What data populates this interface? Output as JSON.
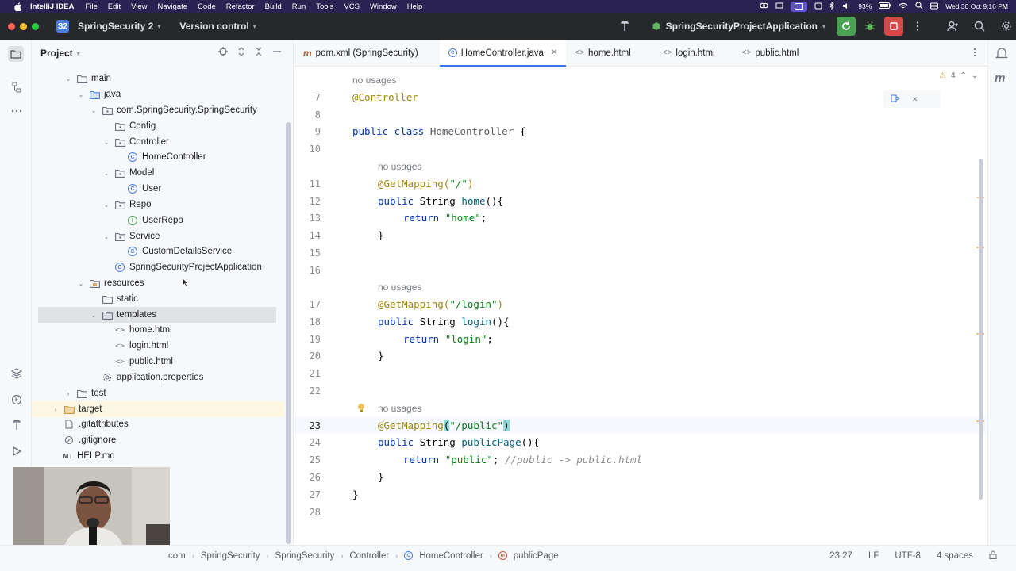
{
  "menubar": {
    "app_name": "IntelliJ IDEA",
    "items": [
      "File",
      "Edit",
      "View",
      "Navigate",
      "Code",
      "Refactor",
      "Build",
      "Run",
      "Tools",
      "VCS",
      "Window",
      "Help"
    ],
    "battery": "93%",
    "datetime": "Wed 30 Oct 9:16 PM"
  },
  "toolbar": {
    "project_badge": "S2",
    "project_name": "SpringSecurity 2",
    "vcs_label": "Version control",
    "run_config": "SpringSecurityProjectApplication",
    "colors": {
      "run_green": "#4aa355",
      "stop_red": "#d44a4a"
    }
  },
  "project_panel": {
    "title": "Project",
    "tree": [
      {
        "label": "main",
        "type": "folder",
        "expanded": true
      },
      {
        "label": "java",
        "type": "folder-src",
        "expanded": true
      },
      {
        "label": "com.SpringSecurity.SpringSecurity",
        "type": "package",
        "expanded": true
      },
      {
        "label": "Config",
        "type": "package"
      },
      {
        "label": "Controller",
        "type": "package",
        "expanded": true
      },
      {
        "label": "HomeController",
        "type": "class"
      },
      {
        "label": "Model",
        "type": "package",
        "expanded": true
      },
      {
        "label": "User",
        "type": "class"
      },
      {
        "label": "Repo",
        "type": "package",
        "expanded": true
      },
      {
        "label": "UserRepo",
        "type": "interface"
      },
      {
        "label": "Service",
        "type": "package",
        "expanded": true
      },
      {
        "label": "CustomDetailsService",
        "type": "class"
      },
      {
        "label": "SpringSecurityProjectApplication",
        "type": "class"
      },
      {
        "label": "resources",
        "type": "folder-res",
        "expanded": true
      },
      {
        "label": "static",
        "type": "folder"
      },
      {
        "label": "templates",
        "type": "folder",
        "expanded": true
      },
      {
        "label": "home.html",
        "type": "html"
      },
      {
        "label": "login.html",
        "type": "html"
      },
      {
        "label": "public.html",
        "type": "html"
      },
      {
        "label": "application.properties",
        "type": "properties"
      },
      {
        "label": "test",
        "type": "folder"
      },
      {
        "label": "target",
        "type": "folder-excluded"
      },
      {
        "label": ".gitattributes",
        "type": "file"
      },
      {
        "label": ".gitignore",
        "type": "file"
      },
      {
        "label": "HELP.md",
        "type": "markdown"
      }
    ]
  },
  "tabs": [
    {
      "label": "pom.xml (SpringSecurity)",
      "icon": "maven-icon",
      "active": false
    },
    {
      "label": "HomeController.java",
      "icon": "class-icon",
      "active": true
    },
    {
      "label": "home.html",
      "icon": "html-icon",
      "active": false
    },
    {
      "label": "login.html",
      "icon": "html-icon",
      "active": false
    },
    {
      "label": "public.html",
      "icon": "html-icon",
      "active": false
    }
  ],
  "editor": {
    "warnings_count": "4",
    "usage_hint": "no usages",
    "lines": {
      "7": "@Controller",
      "9": "public class HomeController {",
      "11": "@GetMapping(\"/\")",
      "12": "public String home(){",
      "13": "return \"home\";",
      "14": "}",
      "17": "@GetMapping(\"/login\")",
      "18": "public String login(){",
      "19": "return \"login\";",
      "20": "}",
      "23": "@GetMapping(\"/public\")",
      "24": "public String publicPage(){",
      "25": "return \"public\"; //public -> public.html",
      "26": "}",
      "27": "}"
    },
    "line_numbers": [
      "7",
      "8",
      "9",
      "10",
      "11",
      "12",
      "13",
      "14",
      "15",
      "16",
      "17",
      "18",
      "19",
      "20",
      "21",
      "22",
      "23",
      "24",
      "25",
      "26",
      "27",
      "28"
    ],
    "current_line": "23"
  },
  "statusbar": {
    "breadcrumb": [
      "SpringSecurity 2",
      "src",
      "main",
      "java",
      "com",
      "SpringSecurity",
      "SpringSecurity",
      "Controller",
      "HomeController",
      "publicPage"
    ],
    "position": "23:27",
    "line_sep": "LF",
    "encoding": "UTF-8",
    "indent": "4 spaces"
  }
}
